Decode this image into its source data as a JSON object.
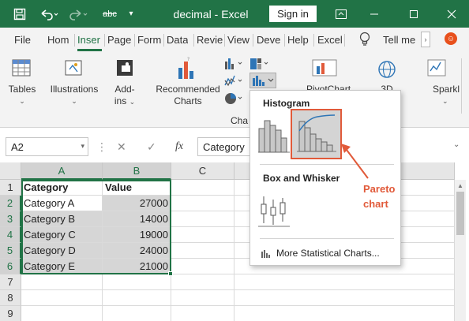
{
  "titlebar": {
    "doc_title": "decimal  -  Excel",
    "signin_label": "Sign in",
    "qat_strike_label": "abc"
  },
  "tabs": [
    {
      "label": "File"
    },
    {
      "label": "Hom"
    },
    {
      "label": "Inser"
    },
    {
      "label": "Page"
    },
    {
      "label": "Form"
    },
    {
      "label": "Data"
    },
    {
      "label": "Revie"
    },
    {
      "label": "View"
    },
    {
      "label": "Deve"
    },
    {
      "label": "Help"
    },
    {
      "label": "Excel"
    },
    {
      "label": "Tell me"
    }
  ],
  "ribbon": {
    "tables": "Tables",
    "illustrations": "Illustrations",
    "addins_1": "Add-",
    "addins_2": "ins",
    "recommended_1": "Recommended",
    "recommended_2": "Charts",
    "charts_group": "Cha",
    "pivotchart": "PivotChart",
    "map_label": "3D",
    "sparklines": "Sparkl"
  },
  "formula_bar": {
    "name_box": "A2",
    "fx": "fx",
    "formula": "Category"
  },
  "sheet": {
    "columns": [
      "A",
      "B",
      "C"
    ],
    "rows": [
      "1",
      "2",
      "3",
      "4",
      "5",
      "6",
      "7",
      "8",
      "9"
    ],
    "header": {
      "category": "Category",
      "value": "Value"
    },
    "data": [
      {
        "category": "Category A",
        "value": "27000"
      },
      {
        "category": "Category B",
        "value": "14000"
      },
      {
        "category": "Category C",
        "value": "19000"
      },
      {
        "category": "Category D",
        "value": "24000"
      },
      {
        "category": "Category E",
        "value": "21000"
      }
    ]
  },
  "dropdown": {
    "histogram": "Histogram",
    "box_whisker": "Box and Whisker",
    "more": "More Statistical Charts..."
  },
  "callout": {
    "line1": "Pareto",
    "line2": "chart"
  },
  "colors": {
    "excel_green": "#217346",
    "accent_red": "#e15a3a"
  }
}
